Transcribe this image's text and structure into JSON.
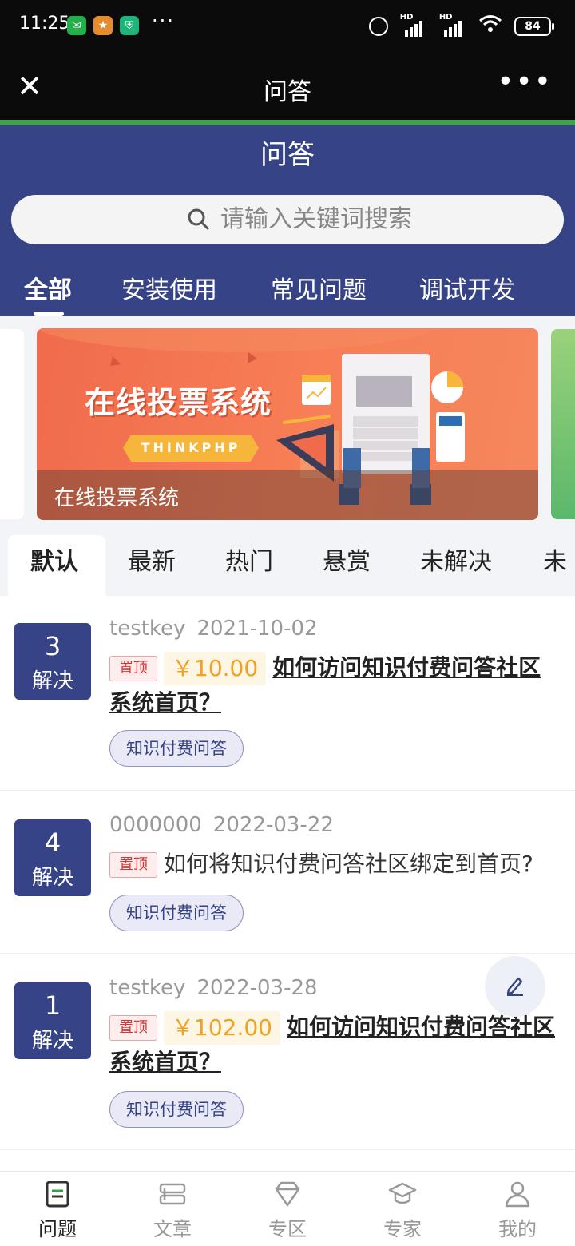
{
  "status_bar": {
    "time": "11:25",
    "battery": "84",
    "network_label": "HD"
  },
  "titlebar": {
    "title": "问答"
  },
  "header": {
    "heading": "问答",
    "search_placeholder": "请输入关键词搜索",
    "category_tabs": [
      "全部",
      "安装使用",
      "常见问题",
      "调试开发"
    ],
    "active_category": "全部"
  },
  "banner": {
    "art_title": "在线投票系统",
    "art_tag": "THINKPHP",
    "caption": "在线投票系统"
  },
  "sort_tabs": [
    "默认",
    "最新",
    "热门",
    "悬赏",
    "未解决",
    "未"
  ],
  "questions": [
    {
      "count": "3",
      "status": "解决",
      "user": "testkey",
      "date": "2021-10-02",
      "pinned": "置顶",
      "price": "￥10.00",
      "title": "如何访问知识付费问答社区系统首页？",
      "tag": "知识付费问答"
    },
    {
      "count": "4",
      "status": "解决",
      "user": "0000000",
      "date": "2022-03-22",
      "pinned": "置顶",
      "price": "",
      "title": "如何将知识付费问答社区绑定到首页?",
      "tag": "知识付费问答"
    },
    {
      "count": "1",
      "status": "解决",
      "user": "testkey",
      "date": "2022-03-28",
      "pinned": "置顶",
      "price": "￥102.00",
      "title": "如何访问知识付费问答社区系统首页？",
      "tag": "知识付费问答"
    }
  ],
  "bottom_nav": [
    {
      "label": "问题",
      "icon": "question-doc-icon",
      "active": true
    },
    {
      "label": "文章",
      "icon": "article-icon",
      "active": false
    },
    {
      "label": "专区",
      "icon": "diamond-icon",
      "active": false
    },
    {
      "label": "专家",
      "icon": "graduation-cap-icon",
      "active": false
    },
    {
      "label": "我的",
      "icon": "user-icon",
      "active": false
    }
  ],
  "colors": {
    "primary": "#364386",
    "accent_green": "#3fa34d",
    "price": "#f0a223",
    "pin": "#d33333"
  }
}
